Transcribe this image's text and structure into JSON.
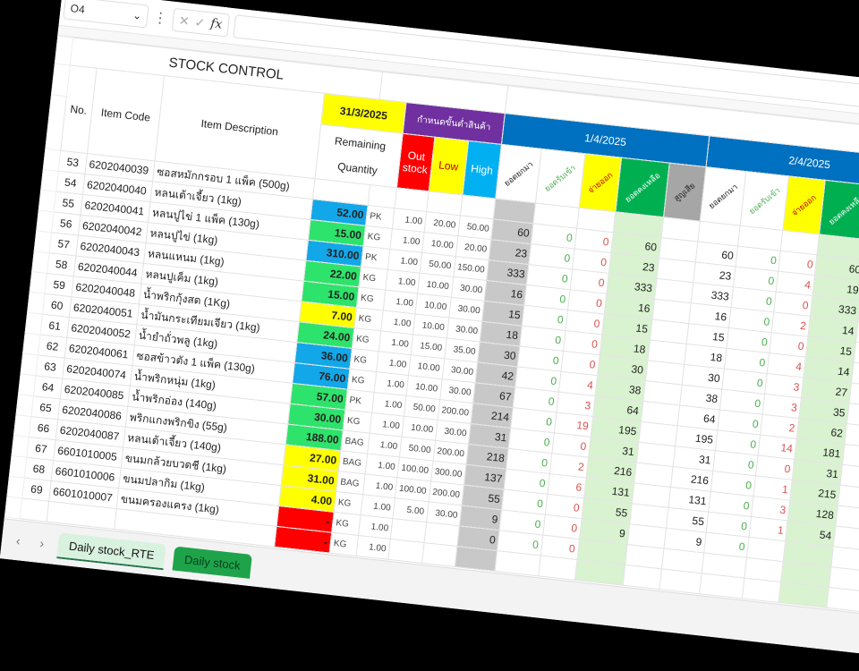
{
  "formula_bar": {
    "name_box": "O4",
    "fx": "fx"
  },
  "title": "STOCK CONTROL",
  "headers": {
    "no": "No.",
    "code": "Item Code",
    "desc": "Item Description",
    "date": "31/3/2025",
    "remaining1": "Remaining",
    "remaining2": "Quantity",
    "min_title": "กำหนดขั้นต่ำสินค้า",
    "out1": "Out",
    "out2": "stock",
    "low": "Low",
    "high": "High"
  },
  "days": [
    {
      "date": "1/4/2025"
    },
    {
      "date": "2/4/2025"
    }
  ],
  "day_cols": [
    "ยอดยกมา",
    "ยอดรับเข้า",
    "จ่ายออก",
    "ยอดคงเหลือ",
    "สูญเสีย"
  ],
  "status_colors": {
    "high": "#12a7e8",
    "normal": "#2ee36b",
    "low": "#ffff00",
    "out": "#ff0000"
  },
  "rows": [
    {
      "no": "53",
      "code": "6202040039",
      "desc": "ซอสหมักกรอบ 1 แพ็ค (500g)",
      "qty": "",
      "unit": "",
      "status": "",
      "min": [
        "",
        "",
        ""
      ],
      "d1": [
        "",
        "",
        "",
        ""
      ],
      "d2": [
        "",
        "",
        "",
        ""
      ]
    },
    {
      "no": "54",
      "code": "6202040040",
      "desc": "หลนเต้าเจี้ยว (1kg)",
      "qty": "52.00",
      "unit": "PK",
      "status": "high",
      "min": [
        "1.00",
        "20.00",
        "50.00"
      ],
      "d1": [
        "60",
        "0",
        "0",
        "60"
      ],
      "d2": [
        "60",
        "0",
        "0",
        "60"
      ]
    },
    {
      "no": "55",
      "code": "6202040041",
      "desc": "หลนปูไข่ 1 แพ็ค (130g)",
      "qty": "15.00",
      "unit": "KG",
      "status": "normal",
      "min": [
        "1.00",
        "10.00",
        "20.00"
      ],
      "d1": [
        "23",
        "0",
        "0",
        "23"
      ],
      "d2": [
        "23",
        "0",
        "4",
        "19"
      ]
    },
    {
      "no": "56",
      "code": "6202040042",
      "desc": "หลนปูไข่ (1kg)",
      "qty": "310.00",
      "unit": "PK",
      "status": "high",
      "min": [
        "1.00",
        "50.00",
        "150.00"
      ],
      "d1": [
        "333",
        "0",
        "0",
        "333"
      ],
      "d2": [
        "333",
        "0",
        "0",
        "333"
      ]
    },
    {
      "no": "57",
      "code": "6202040043",
      "desc": "หลนแหนม (1kg)",
      "qty": "22.00",
      "unit": "KG",
      "status": "normal",
      "min": [
        "1.00",
        "10.00",
        "30.00"
      ],
      "d1": [
        "16",
        "0",
        "0",
        "16"
      ],
      "d2": [
        "16",
        "0",
        "2",
        "14"
      ]
    },
    {
      "no": "58",
      "code": "6202040044",
      "desc": "หลนปูเค็ม (1kg)",
      "qty": "15.00",
      "unit": "KG",
      "status": "normal",
      "min": [
        "1.00",
        "10.00",
        "30.00"
      ],
      "d1": [
        "15",
        "0",
        "0",
        "15"
      ],
      "d2": [
        "15",
        "0",
        "0",
        "15"
      ]
    },
    {
      "no": "59",
      "code": "6202040048",
      "desc": "น้ำพริกกุ้งสด (1Kg)",
      "qty": "7.00",
      "unit": "KG",
      "status": "low",
      "min": [
        "1.00",
        "10.00",
        "30.00"
      ],
      "d1": [
        "18",
        "0",
        "0",
        "18"
      ],
      "d2": [
        "18",
        "0",
        "4",
        "14"
      ]
    },
    {
      "no": "60",
      "code": "6202040051",
      "desc": "น้ำมันกระเทียมเจียว (1kg)",
      "qty": "24.00",
      "unit": "KG",
      "status": "normal",
      "min": [
        "1.00",
        "15.00",
        "35.00"
      ],
      "d1": [
        "30",
        "0",
        "0",
        "30"
      ],
      "d2": [
        "30",
        "0",
        "3",
        "27"
      ]
    },
    {
      "no": "61",
      "code": "6202040052",
      "desc": "น้ำยำถั่วพลู (1kg)",
      "qty": "36.00",
      "unit": "KG",
      "status": "high",
      "min": [
        "1.00",
        "10.00",
        "30.00"
      ],
      "d1": [
        "42",
        "0",
        "4",
        "38"
      ],
      "d2": [
        "38",
        "0",
        "3",
        "35"
      ]
    },
    {
      "no": "62",
      "code": "6202040061",
      "desc": "ซอสข้าวตัง 1 แพ็ค (130g)",
      "qty": "76.00",
      "unit": "KG",
      "status": "high",
      "min": [
        "1.00",
        "10.00",
        "30.00"
      ],
      "d1": [
        "67",
        "0",
        "3",
        "64"
      ],
      "d2": [
        "64",
        "0",
        "2",
        "62"
      ]
    },
    {
      "no": "63",
      "code": "6202040074",
      "desc": "น้ำพริกหนุ่ม (1kg)",
      "qty": "57.00",
      "unit": "PK",
      "status": "normal",
      "min": [
        "1.00",
        "50.00",
        "200.00"
      ],
      "d1": [
        "214",
        "0",
        "19",
        "195"
      ],
      "d2": [
        "195",
        "0",
        "14",
        "181"
      ]
    },
    {
      "no": "64",
      "code": "6202040085",
      "desc": "น้ำพริกอ่อง (140g)",
      "qty": "30.00",
      "unit": "KG",
      "status": "normal",
      "min": [
        "1.00",
        "10.00",
        "30.00"
      ],
      "d1": [
        "31",
        "0",
        "0",
        "31"
      ],
      "d2": [
        "31",
        "0",
        "0",
        "31"
      ]
    },
    {
      "no": "65",
      "code": "6202040086",
      "desc": "พริกแกงพริกขิง (55g)",
      "qty": "188.00",
      "unit": "BAG",
      "status": "normal",
      "min": [
        "1.00",
        "50.00",
        "200.00"
      ],
      "d1": [
        "218",
        "0",
        "2",
        "216"
      ],
      "d2": [
        "216",
        "0",
        "1",
        "215"
      ]
    },
    {
      "no": "66",
      "code": "6202040087",
      "desc": "หลนเต้าเจี้ยว (140g)",
      "qty": "27.00",
      "unit": "BAG",
      "status": "low",
      "min": [
        "1.00",
        "100.00",
        "300.00"
      ],
      "d1": [
        "137",
        "0",
        "6",
        "131"
      ],
      "d2": [
        "131",
        "0",
        "3",
        "128"
      ]
    },
    {
      "no": "67",
      "code": "6601010005",
      "desc": "ขนมกล้วยบวดชี (1kg)",
      "qty": "31.00",
      "unit": "BAG",
      "status": "low",
      "min": [
        "1.00",
        "100.00",
        "200.00"
      ],
      "d1": [
        "55",
        "0",
        "0",
        "55"
      ],
      "d2": [
        "55",
        "0",
        "1",
        "54"
      ]
    },
    {
      "no": "68",
      "code": "6601010006",
      "desc": "ขนมปลากิม (1kg)",
      "qty": "4.00",
      "unit": "KG",
      "status": "low",
      "min": [
        "1.00",
        "5.00",
        "30.00"
      ],
      "d1": [
        "9",
        "0",
        "0",
        "9"
      ],
      "d2": [
        "9",
        "0",
        "",
        ""
      ]
    },
    {
      "no": "69",
      "code": "6601010007",
      "desc": "ขนมครองแครง (1kg)",
      "qty": "-",
      "unit": "KG",
      "status": "out",
      "min": [
        "1.00",
        "",
        ""
      ],
      "d1": [
        "0",
        "0",
        "0",
        ""
      ],
      "d2": [
        "",
        "",
        "",
        ""
      ]
    },
    {
      "no": "",
      "code": "",
      "desc": "",
      "qty": "-",
      "unit": "KG",
      "status": "out",
      "min": [
        "1.00",
        "",
        ""
      ],
      "d1": [
        "",
        "",
        "",
        ""
      ],
      "d2": [
        "",
        "",
        "",
        ""
      ]
    }
  ],
  "tabs": [
    "Daily stock_RTE",
    "Daily stock"
  ]
}
